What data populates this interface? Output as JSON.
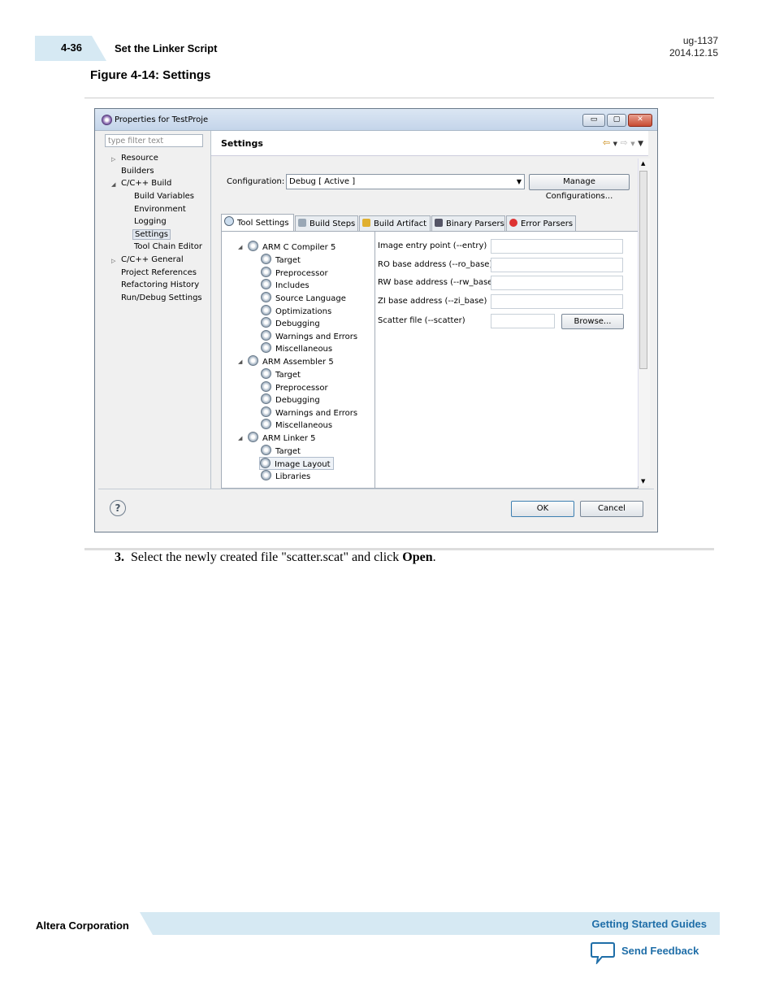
{
  "header": {
    "section_number": "4-36",
    "section_title": "Set the Linker Script",
    "doc_id": "ug-1137",
    "doc_date": "2014.12.15"
  },
  "figure": {
    "title": "Figure 4-14: Settings"
  },
  "dialog": {
    "title": "Properties for TestProje",
    "window_buttons": {
      "minimize": "▭",
      "maximize": "▢",
      "close": "✕"
    },
    "filter_placeholder": "type filter text",
    "nav_tree": [
      "Resource",
      "Builders",
      "C/C++ Build",
      "Build Variables",
      "Environment",
      "Logging",
      "Settings",
      "Tool Chain Editor",
      "C/C++ General",
      "Project References",
      "Refactoring History",
      "Run/Debug Settings"
    ],
    "page_title": "Settings",
    "config_label": "Configuration:",
    "config_value": "Debug  [ Active ]",
    "manage_button": "Manage Configurations...",
    "tabs": [
      "Tool Settings",
      "Build Steps",
      "Build Artifact",
      "Binary Parsers",
      "Error Parsers"
    ],
    "tool_tree": [
      "ARM C Compiler 5",
      "Target",
      "Preprocessor",
      "Includes",
      "Source Language",
      "Optimizations",
      "Debugging",
      "Warnings and Errors",
      "Miscellaneous",
      "ARM Assembler 5",
      "Target",
      "Preprocessor",
      "Debugging",
      "Warnings and Errors",
      "Miscellaneous",
      "ARM Linker 5",
      "Target",
      "Image Layout",
      "Libraries"
    ],
    "fields": [
      "Image entry point (--entry)",
      "RO base address (--ro_base)",
      "RW base address (--rw_base)",
      "ZI base address (--zi_base)",
      "Scatter file (--scatter)"
    ],
    "browse_button": "Browse...",
    "ok_button": "OK",
    "cancel_button": "Cancel",
    "help_icon": "?"
  },
  "step": {
    "number": "3.",
    "text_before": "Select the newly created file \"scatter.scat\" and click ",
    "bold": "Open",
    "text_after": "."
  },
  "footer": {
    "company": "Altera Corporation",
    "guides": "Getting Started Guides",
    "feedback": "Send Feedback"
  },
  "colors": {
    "accent_band": "#d6e9f3",
    "link": "#1f6ea8"
  }
}
